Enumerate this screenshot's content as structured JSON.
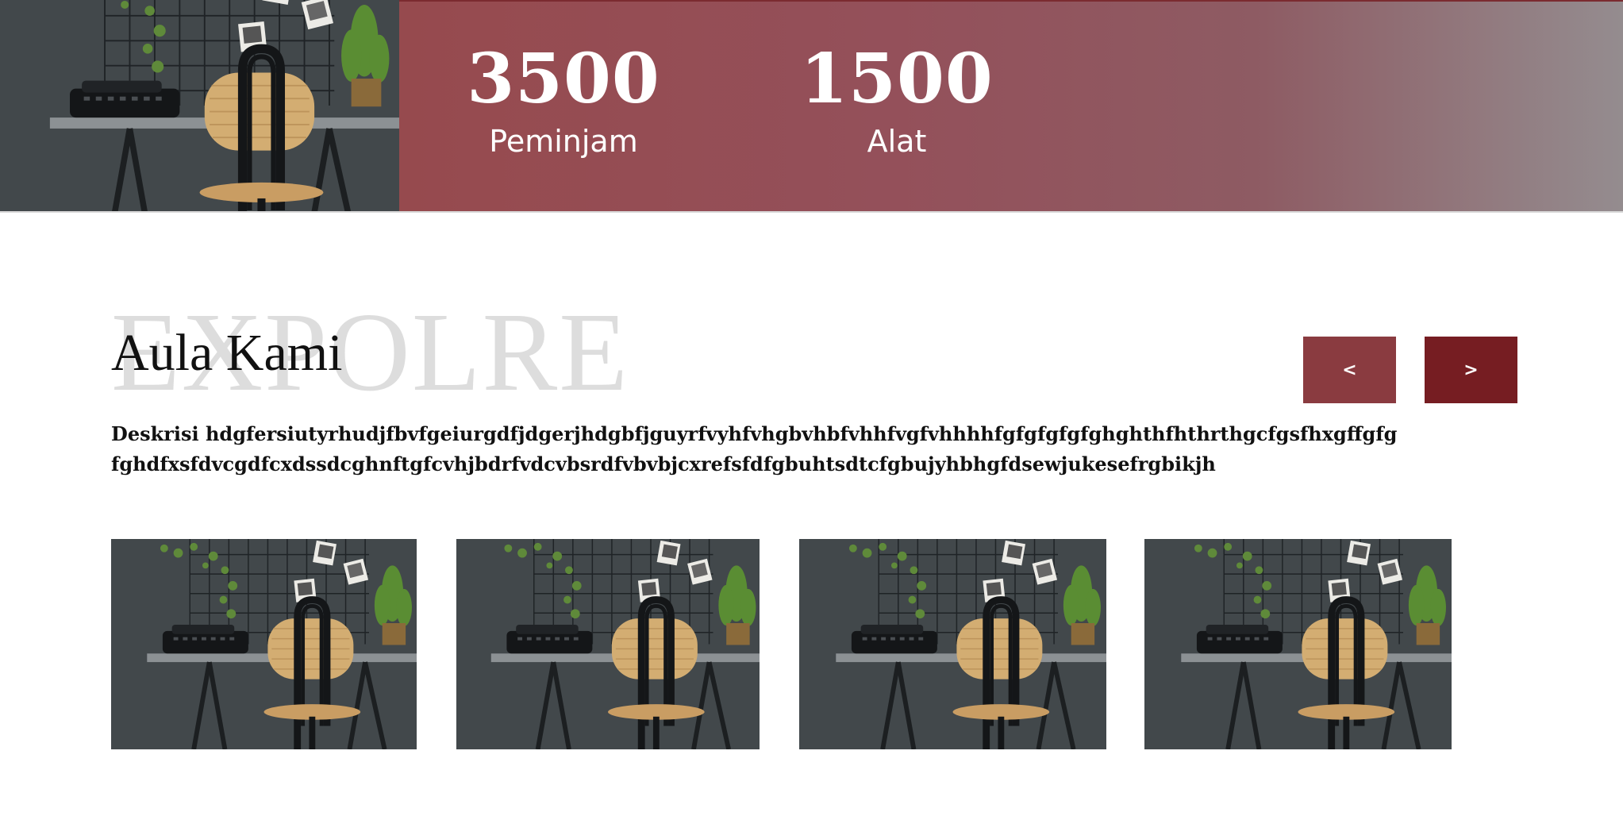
{
  "stats": [
    {
      "number": "3500",
      "label": "Peminjam"
    },
    {
      "number": "1500",
      "label": "Alat"
    }
  ],
  "section": {
    "watermark": "EXPOLRE",
    "title": "Aula Kami",
    "description_line1": "Deskrisi hdgfersiutyrhudjfbvfgeiurgdfjdgerjhdgbfjguyrfvyhfvhgbvhbfvhhfvgfvhhhhfgfgfgfgfghghthfhthrthgcfgsfhxgffgfg",
    "description_line2": "fghdfxsfdvcgdfcxdssdcghnftgfcvhjbdrfvdcvbsrdfvbvbjcxrefsfdfgbuhtsdtcfgbujyhbhgfdsewjukesefrgbikjh",
    "prev_label": "<",
    "next_label": ">"
  },
  "gallery_count": 4,
  "colors": {
    "stats_band_start": "#964a4e",
    "stats_band_end": "#948c8f",
    "prev_button": "#8a3b40",
    "next_button": "#761d22",
    "watermark": "#dddddd"
  }
}
